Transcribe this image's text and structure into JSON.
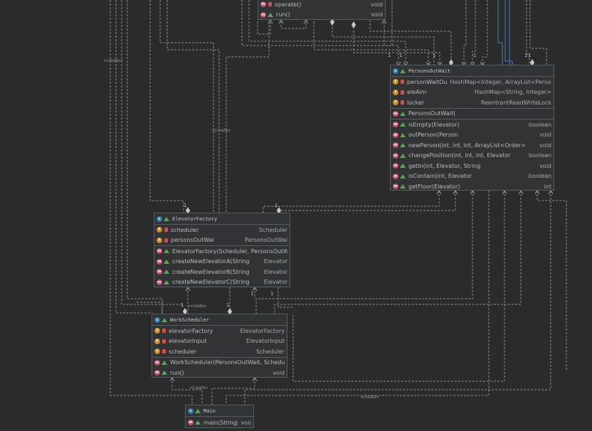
{
  "top_partial": {
    "rows": [
      {
        "name": "operate()",
        "type": "void"
      },
      {
        "name": "run()",
        "type": "void"
      }
    ]
  },
  "persons_out_wait": {
    "title": "PersonsOutWait",
    "fields": [
      {
        "name": "personWaitOu",
        "type": "HashMap<Integer, ArrayList<Person>"
      },
      {
        "name": "eleAim",
        "type": "HashMap<String, Integer>"
      },
      {
        "name": "locker",
        "type": "ReentrantReadWriteLock"
      }
    ],
    "constructors": [
      {
        "name": "PersonsOutWait(",
        "type": ""
      }
    ],
    "methods": [
      {
        "name": "isEmpty(Elevator)",
        "type": "boolean"
      },
      {
        "name": "outPerson(Person",
        "type": "void"
      },
      {
        "name": "newPerson(int, int, int, ArrayList<Order>",
        "type": "void"
      },
      {
        "name": "changePosition(int, int, int, Elevator",
        "type": "boolean"
      },
      {
        "name": "getIn(int, Elevator, String",
        "type": "void"
      },
      {
        "name": "isContain(int, Elevator",
        "type": "boolean"
      },
      {
        "name": "getFloor(Elevator)",
        "type": "int"
      }
    ]
  },
  "elevator_factory": {
    "title": "ElevatorFactory",
    "fields": [
      {
        "name": "scheduler",
        "type": "Scheduler"
      },
      {
        "name": "personsOutWai",
        "type": "PersonsOutWai"
      }
    ],
    "methods": [
      {
        "name": "ElevatorFactory(Scheduler, PersonsOutWai",
        "type": ""
      },
      {
        "name": "createNewElevatorA(String",
        "type": "Elevator"
      },
      {
        "name": "createNewElevatorB(String",
        "type": "Elevator"
      },
      {
        "name": "createNewElevatorC(String",
        "type": "Elevator"
      }
    ]
  },
  "work_scheduler": {
    "title": "WorkScheduler",
    "fields": [
      {
        "name": "elevatorFactory",
        "type": "ElevatorFactory"
      },
      {
        "name": "elevatorInput",
        "type": "ElevatorInput"
      },
      {
        "name": "scheduler",
        "type": "Scheduler"
      }
    ],
    "methods": [
      {
        "name": "WorkScheduler(PersonsOutWait, Schedule",
        "type": ""
      },
      {
        "name": "run()",
        "type": "void"
      }
    ]
  },
  "main_class": {
    "title": "Main",
    "methods": [
      {
        "name": "main(String[])",
        "type": "void"
      }
    ]
  },
  "labels": {
    "create_1": "«create»",
    "create_2": "«create»",
    "create_3": "«create»",
    "create_4": "«create»",
    "create_5": "«create»"
  },
  "multiplicities": {
    "m1": "1",
    "m2": "1",
    "m3": "1",
    "m4": "1",
    "m5": "1",
    "m6": "1",
    "m7": "1",
    "m8": "1",
    "m9": "1",
    "m10": "1",
    "m11": "1",
    "m12": "1"
  },
  "colors": {
    "background": "#2b2b2b",
    "box": "#313335",
    "line": "#8c8c8c",
    "blue_line": "#4a7ec4"
  }
}
